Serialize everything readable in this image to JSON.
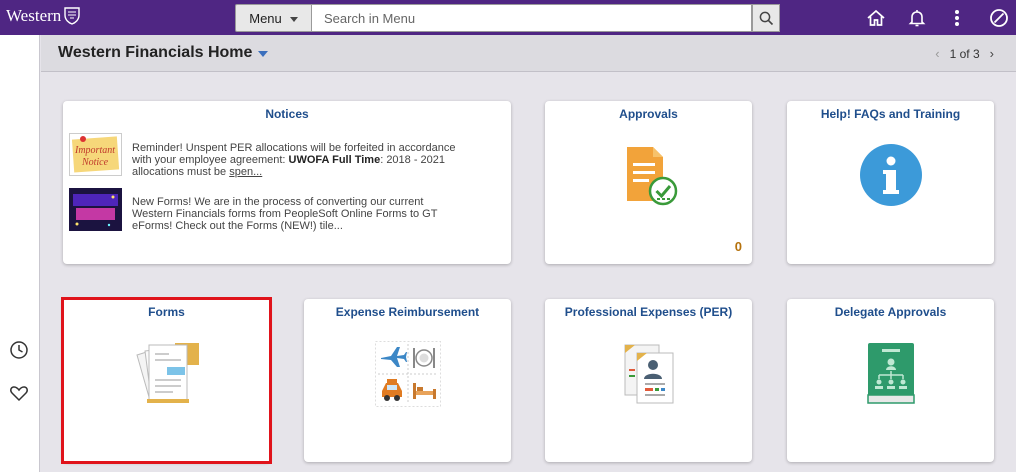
{
  "header": {
    "brand": "Western",
    "menu_label": "Menu",
    "search_placeholder": "Search in Menu",
    "icons": [
      "home-icon",
      "bell-icon",
      "more-vertical-icon",
      "nav-bar-icon"
    ]
  },
  "titlebar": {
    "title": "Western Financials Home",
    "pager": "1 of 3"
  },
  "left_rail": {
    "icons": [
      "recent-history-icon",
      "favorites-heart-icon"
    ]
  },
  "tiles": {
    "notices": {
      "title": "Notices",
      "items": [
        {
          "image": "important-notice-image",
          "text_before": "Reminder! Unspent PER allocations will be forfeited in accordance with your employee agreement: ",
          "text_bold": "UWOFA Full Time",
          "text_after": ": 2018 - 2021 allocations must be ",
          "text_link": "spen..."
        },
        {
          "image": "coming-soon-image",
          "text": "New Forms! We are in the process of converting our current Western Financials forms from PeopleSoft Online Forms to GT eForms! Check out the Forms (NEW!) tile..."
        }
      ]
    },
    "approvals": {
      "title": "Approvals",
      "count": "0",
      "icon": "approvals-document-icon"
    },
    "help": {
      "title": "Help! FAQs and Training",
      "icon": "info-circle-icon"
    },
    "forms": {
      "title": "Forms",
      "icon": "forms-documents-icon"
    },
    "expense": {
      "title": "Expense Reimbursement",
      "icon": "travel-expense-icon"
    },
    "per": {
      "title": "Professional Expenses (PER)",
      "icon": "professional-expense-cards-icon"
    },
    "delegate": {
      "title": "Delegate Approvals",
      "icon": "delegate-book-icon"
    }
  },
  "colors": {
    "header_bg": "#4f2683",
    "tile_title": "#1f4e8c",
    "highlight": "#e0131b",
    "count": "#b5720d"
  }
}
